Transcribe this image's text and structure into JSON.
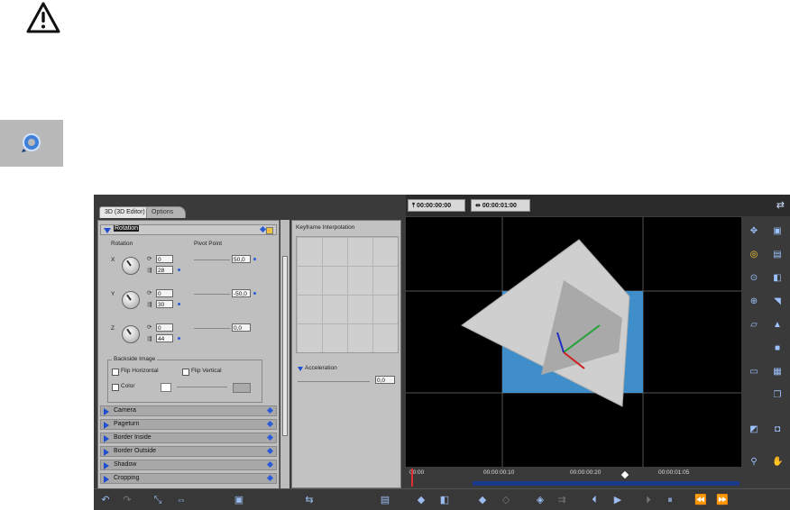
{
  "app": {
    "tabs": [
      {
        "label": "3D (3D Editor)"
      },
      {
        "label": "Options"
      }
    ],
    "rotation": {
      "header": "Rotation",
      "rotation_label": "Rotation",
      "pivot_label": "Pivot Point",
      "axes": [
        {
          "axis": "X",
          "angle": "0",
          "speed": "28",
          "pivot": "50,0"
        },
        {
          "axis": "Y",
          "angle": "0",
          "speed": "30",
          "pivot": "-50,0"
        },
        {
          "axis": "Z",
          "angle": "0",
          "speed": "44",
          "pivot": "0,0"
        }
      ],
      "backside": {
        "legend": "Backside Image",
        "flip_h": "Flip Horizontal",
        "flip_v": "Flip Vertical",
        "color": "Color"
      }
    },
    "sections": [
      "Camera",
      "Pageturn",
      "Border Inside",
      "Border Outside",
      "Shadow",
      "Cropping"
    ],
    "keyframe": {
      "title": "Keyframe Interpolation",
      "acceleration_label": "Acceleration",
      "acceleration_value": "0,0"
    },
    "time": {
      "start": "00:00:00:00",
      "duration": "00:00:01:00"
    },
    "timeline_labels": [
      "00:00",
      "00:00:00:10",
      "00:00:00:20",
      "00:00:01:05"
    ],
    "accent": "#2a5bd8"
  }
}
